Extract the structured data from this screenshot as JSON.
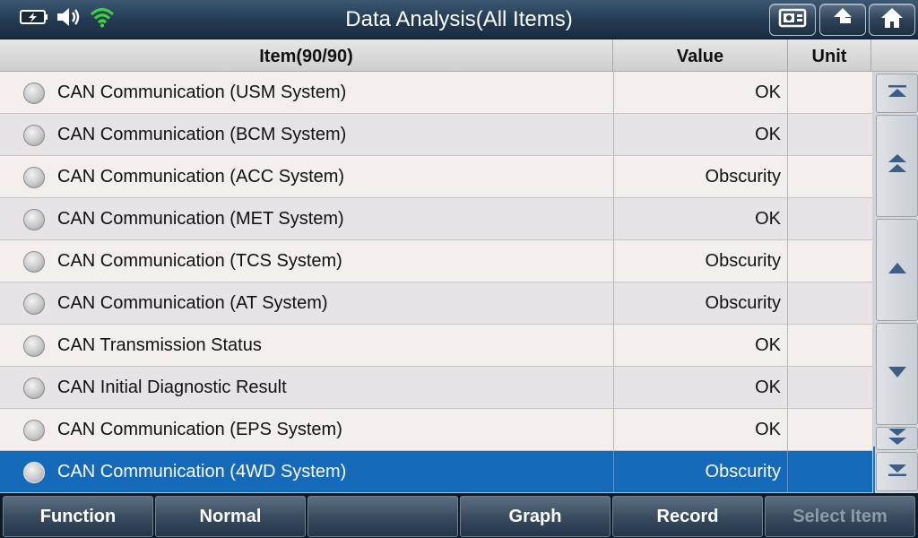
{
  "header": {
    "title": "Data Analysis(All Items)",
    "status_icons": [
      "battery-icon",
      "speaker-icon",
      "wifi-icon"
    ],
    "buttons": [
      "screenshot-icon",
      "back-icon",
      "home-icon"
    ]
  },
  "table": {
    "columns": {
      "item": "Item(90/90)",
      "value": "Value",
      "unit": "Unit"
    },
    "rows": [
      {
        "name": "CAN Communication (USM System)",
        "value": "OK",
        "unit": ""
      },
      {
        "name": "CAN Communication (BCM System)",
        "value": "OK",
        "unit": ""
      },
      {
        "name": "CAN Communication (ACC System)",
        "value": "Obscurity",
        "unit": ""
      },
      {
        "name": "CAN Communication (MET System)",
        "value": "OK",
        "unit": ""
      },
      {
        "name": "CAN Communication (TCS System)",
        "value": "Obscurity",
        "unit": ""
      },
      {
        "name": "CAN Communication (AT System)",
        "value": "Obscurity",
        "unit": ""
      },
      {
        "name": "CAN Transmission Status",
        "value": "OK",
        "unit": ""
      },
      {
        "name": "CAN Initial Diagnostic Result",
        "value": "OK",
        "unit": ""
      },
      {
        "name": "CAN Communication (EPS System)",
        "value": "OK",
        "unit": ""
      },
      {
        "name": "CAN Communication (4WD System)",
        "value": "Obscurity",
        "unit": ""
      }
    ],
    "selected_index": 9
  },
  "scroll_buttons": [
    "scroll-top-icon",
    "page-up-icon",
    "line-up-icon",
    "line-down-icon",
    "page-down-icon",
    "scroll-bottom-icon"
  ],
  "bottom_bar": {
    "function": "Function",
    "normal": "Normal",
    "empty": "",
    "graph": "Graph",
    "record": "Record",
    "select_item": "Select Item"
  },
  "colors": {
    "selected_row": "#1469b8",
    "wifi": "#3fd23f",
    "title_bar": "#223a52"
  }
}
